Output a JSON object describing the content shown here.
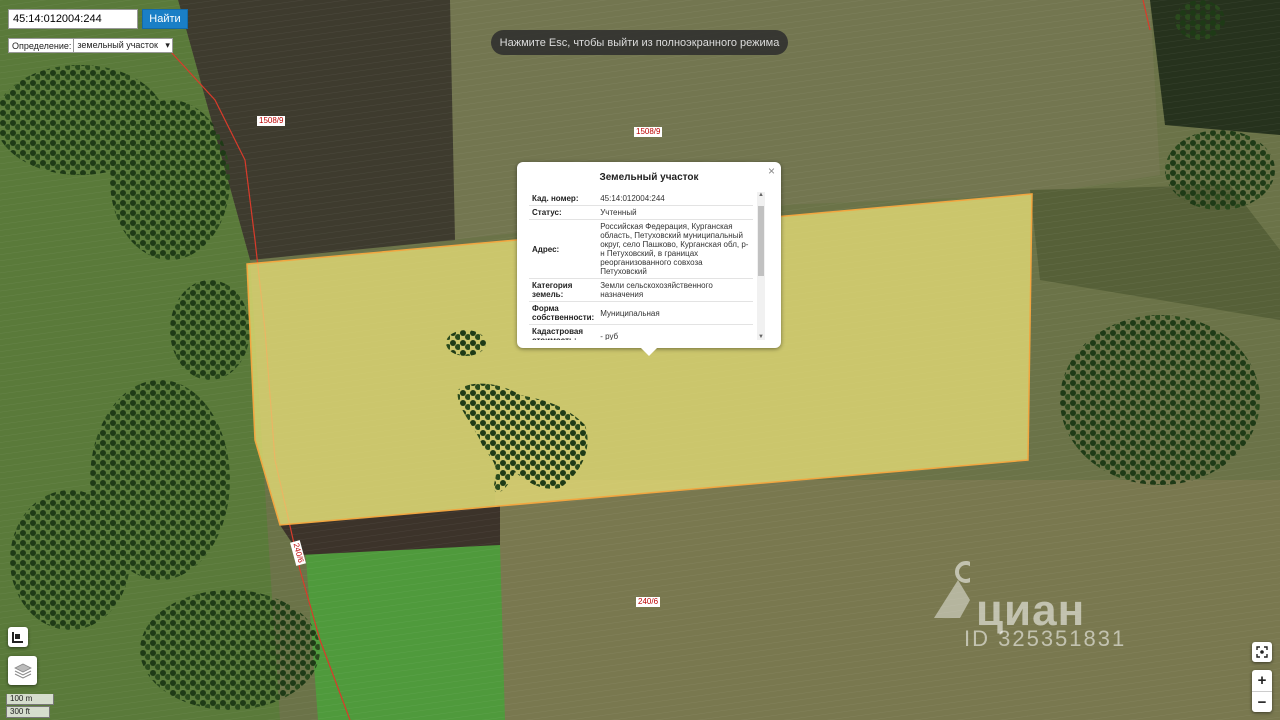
{
  "search": {
    "value": "45:14:012004:244",
    "button_label": "Найти"
  },
  "definition": {
    "label": "Определение:",
    "selected": "земельный участок"
  },
  "fullscreen_hint": "Нажмите Esc, чтобы выйти из полноэкранного режима",
  "parcel_labels": [
    "1508/9",
    "1508/9",
    "240/6",
    "240/6"
  ],
  "popup": {
    "title": "Земельный участок",
    "close": "×",
    "rows": [
      {
        "key": "Кад. номер:",
        "value": "45:14:012004:244"
      },
      {
        "key": "Статус:",
        "value": "Учтенный"
      },
      {
        "key": "Адрес:",
        "value": "Российская Федерация, Курганская область, Петуховский муниципальный округ, село Пашково, Курганская обл, р-н Петуховский, в границах реорганизованного совхоза Петуховский"
      },
      {
        "key": "Категория земель:",
        "value": "Земли сельскохозяйственного назначения"
      },
      {
        "key": "Форма собственности:",
        "value": "Муниципальная"
      },
      {
        "key": "Кадастровая стоимость:",
        "value": "- руб"
      }
    ]
  },
  "scale": {
    "metric": "100 m",
    "imperial": "300 ft"
  },
  "zoom": {
    "in": "+",
    "out": "−"
  },
  "watermark": {
    "brand": "циан",
    "id": "ID 325351831"
  },
  "colors": {
    "parcel_fill": "#f0e67a",
    "parcel_stroke": "#f2a640",
    "boundary": "#d93b2b",
    "button": "#1a7fc6"
  }
}
